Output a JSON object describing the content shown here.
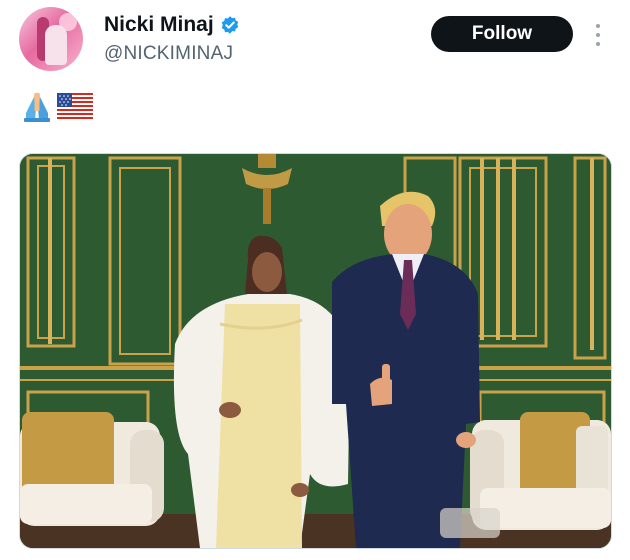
{
  "author": {
    "display_name": "Nicki Minaj",
    "handle": "@NICKIMINAJ",
    "verified": true,
    "verified_color": "#1d9bf0"
  },
  "actions": {
    "follow_label": "Follow",
    "more_icon": "more-vertical-icon"
  },
  "tweet": {
    "emojis": [
      "folded-hands-emoji",
      "us-flag-emoji"
    ]
  },
  "media": {
    "type": "photo",
    "description_icon": "photo"
  },
  "colors": {
    "follow_button_bg": "#0f1419",
    "handle": "#536471",
    "wall_green": "#2f5a33",
    "gold_trim": "#c9a24a"
  }
}
